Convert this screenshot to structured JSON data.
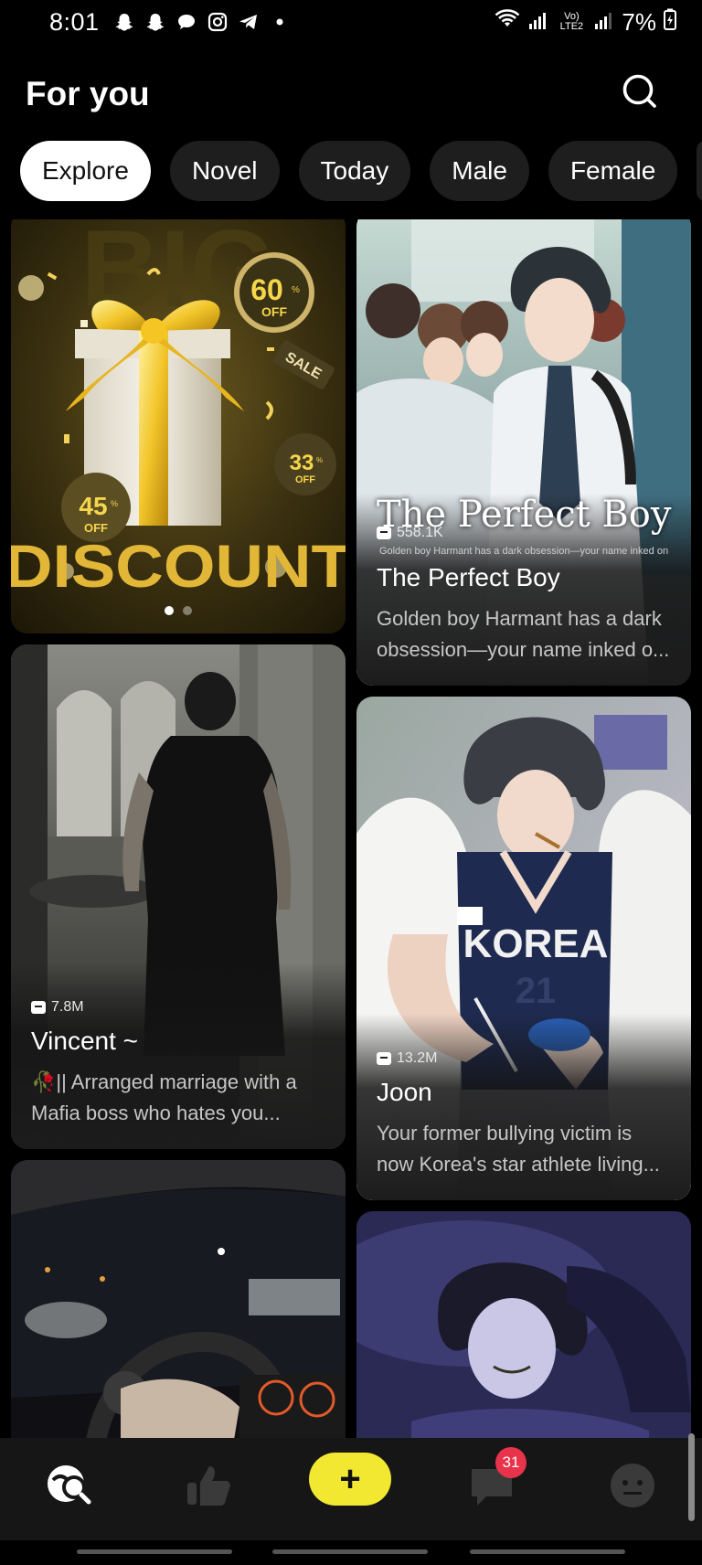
{
  "status_bar": {
    "time": "8:01",
    "battery": "7%",
    "network_label": "Vo) LTE2",
    "icons": [
      "snapchat-icon",
      "snapchat-icon",
      "chat-bubble-icon",
      "instagram-icon",
      "telegram-icon",
      "dot-icon"
    ]
  },
  "header": {
    "title": "For you",
    "search_icon": "search-icon"
  },
  "tabs": [
    {
      "label": "Explore",
      "active": true
    },
    {
      "label": "Novel",
      "active": false
    },
    {
      "label": "Today",
      "active": false
    },
    {
      "label": "Male",
      "active": false
    },
    {
      "label": "Female",
      "active": false
    }
  ],
  "banner": {
    "headline": "BIG",
    "word": "DISCOUNT",
    "badges": [
      {
        "value": "60",
        "unit": "%",
        "label": "OFF"
      },
      {
        "value": "33",
        "unit": "%",
        "label": "OFF"
      },
      {
        "value": "45",
        "unit": "%",
        "label": "OFF"
      }
    ],
    "tag": "SALE",
    "page_count": 2,
    "current_page": 1
  },
  "cards": [
    {
      "title": "The Perfect Boy",
      "art_title": "The Perfect Boy",
      "art_caption": "Golden boy Harmant has a dark obsession—your name inked on his wrist.",
      "views": "558.1K",
      "description": "Golden boy Harmant has a dark obsession—your name inked o..."
    },
    {
      "title": "Vincent ~",
      "views": "7.8M",
      "description": "🥀|| Arranged marriage with a Mafia boss who hates you..."
    },
    {
      "title": "Joon",
      "views": "13.2M",
      "description": "Your former bullying victim is now Korea's star athlete living...",
      "jersey_text": "KOREA",
      "jersey_number": "21"
    }
  ],
  "bottom_nav": {
    "items": [
      "explore-icon",
      "thumbs-up-icon",
      "create-icon",
      "messages-icon",
      "profile-icon"
    ],
    "create_label": "+",
    "messages_badge": "31"
  },
  "colors": {
    "background": "#000000",
    "accent": "#f3e831",
    "badge": "#e8334a",
    "tab_inactive": "#1e1e1e"
  }
}
